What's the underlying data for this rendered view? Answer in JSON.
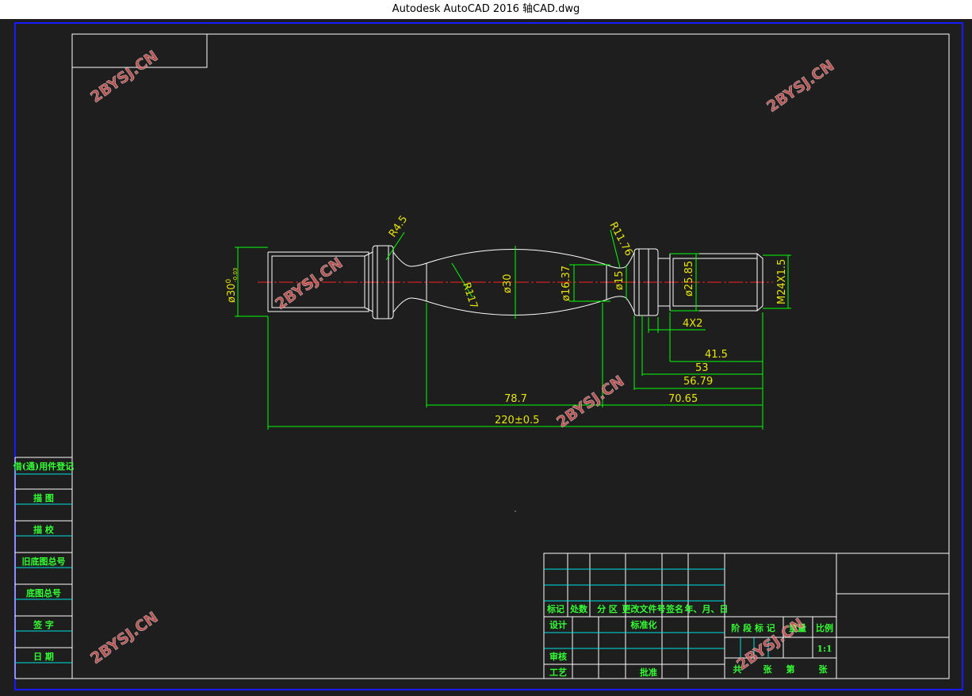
{
  "window": {
    "title": "Autodesk AutoCAD 2016     轴CAD.dwg"
  },
  "dimensions": {
    "r45": "R4.5",
    "r1176": "R11.76",
    "d30tol_main": "ø30",
    "d30tol_upper": "0",
    "d30tol_lower": "-0.03",
    "r117": "R117",
    "d30": "ø30",
    "d1637": "ø16.37",
    "d15": "ø15",
    "d2585": "ø25.85",
    "m24": "M24X1.5",
    "groove": "4X2",
    "len415": "41.5",
    "len53": "53",
    "len5679": "56.79",
    "len787": "78.7",
    "len7065": "70.65",
    "len220": "220±0.5"
  },
  "side_table": {
    "rows": [
      "借(通)用件登记",
      "描  图",
      "描  校",
      "旧底图总号",
      "底图总号",
      "签  字",
      "日  期"
    ]
  },
  "title_block": {
    "header_cells": [
      "标记",
      "处数",
      "分  区",
      "更改文件号",
      "签名",
      "年、月、日"
    ],
    "row_design": "设计",
    "row_standard": "标准化",
    "row_review": "审核",
    "row_process": "工艺",
    "row_approve": "批准",
    "stage_mark": "阶 段 标 记",
    "weight": "重量",
    "scale_label": "比例",
    "scale_value": "1:1",
    "sheet_total": "共",
    "sheet_count": "张",
    "sheet_no": "第",
    "sheet_no_unit": "张"
  },
  "watermark": "2BYSJ.CN",
  "colors": {
    "background": "#1e1e1e",
    "border_blue": "#1a1aff",
    "dimension": "#00ff00",
    "dim_text": "#e6e600",
    "centerline": "#ff2020",
    "outline": "#ffffff"
  }
}
